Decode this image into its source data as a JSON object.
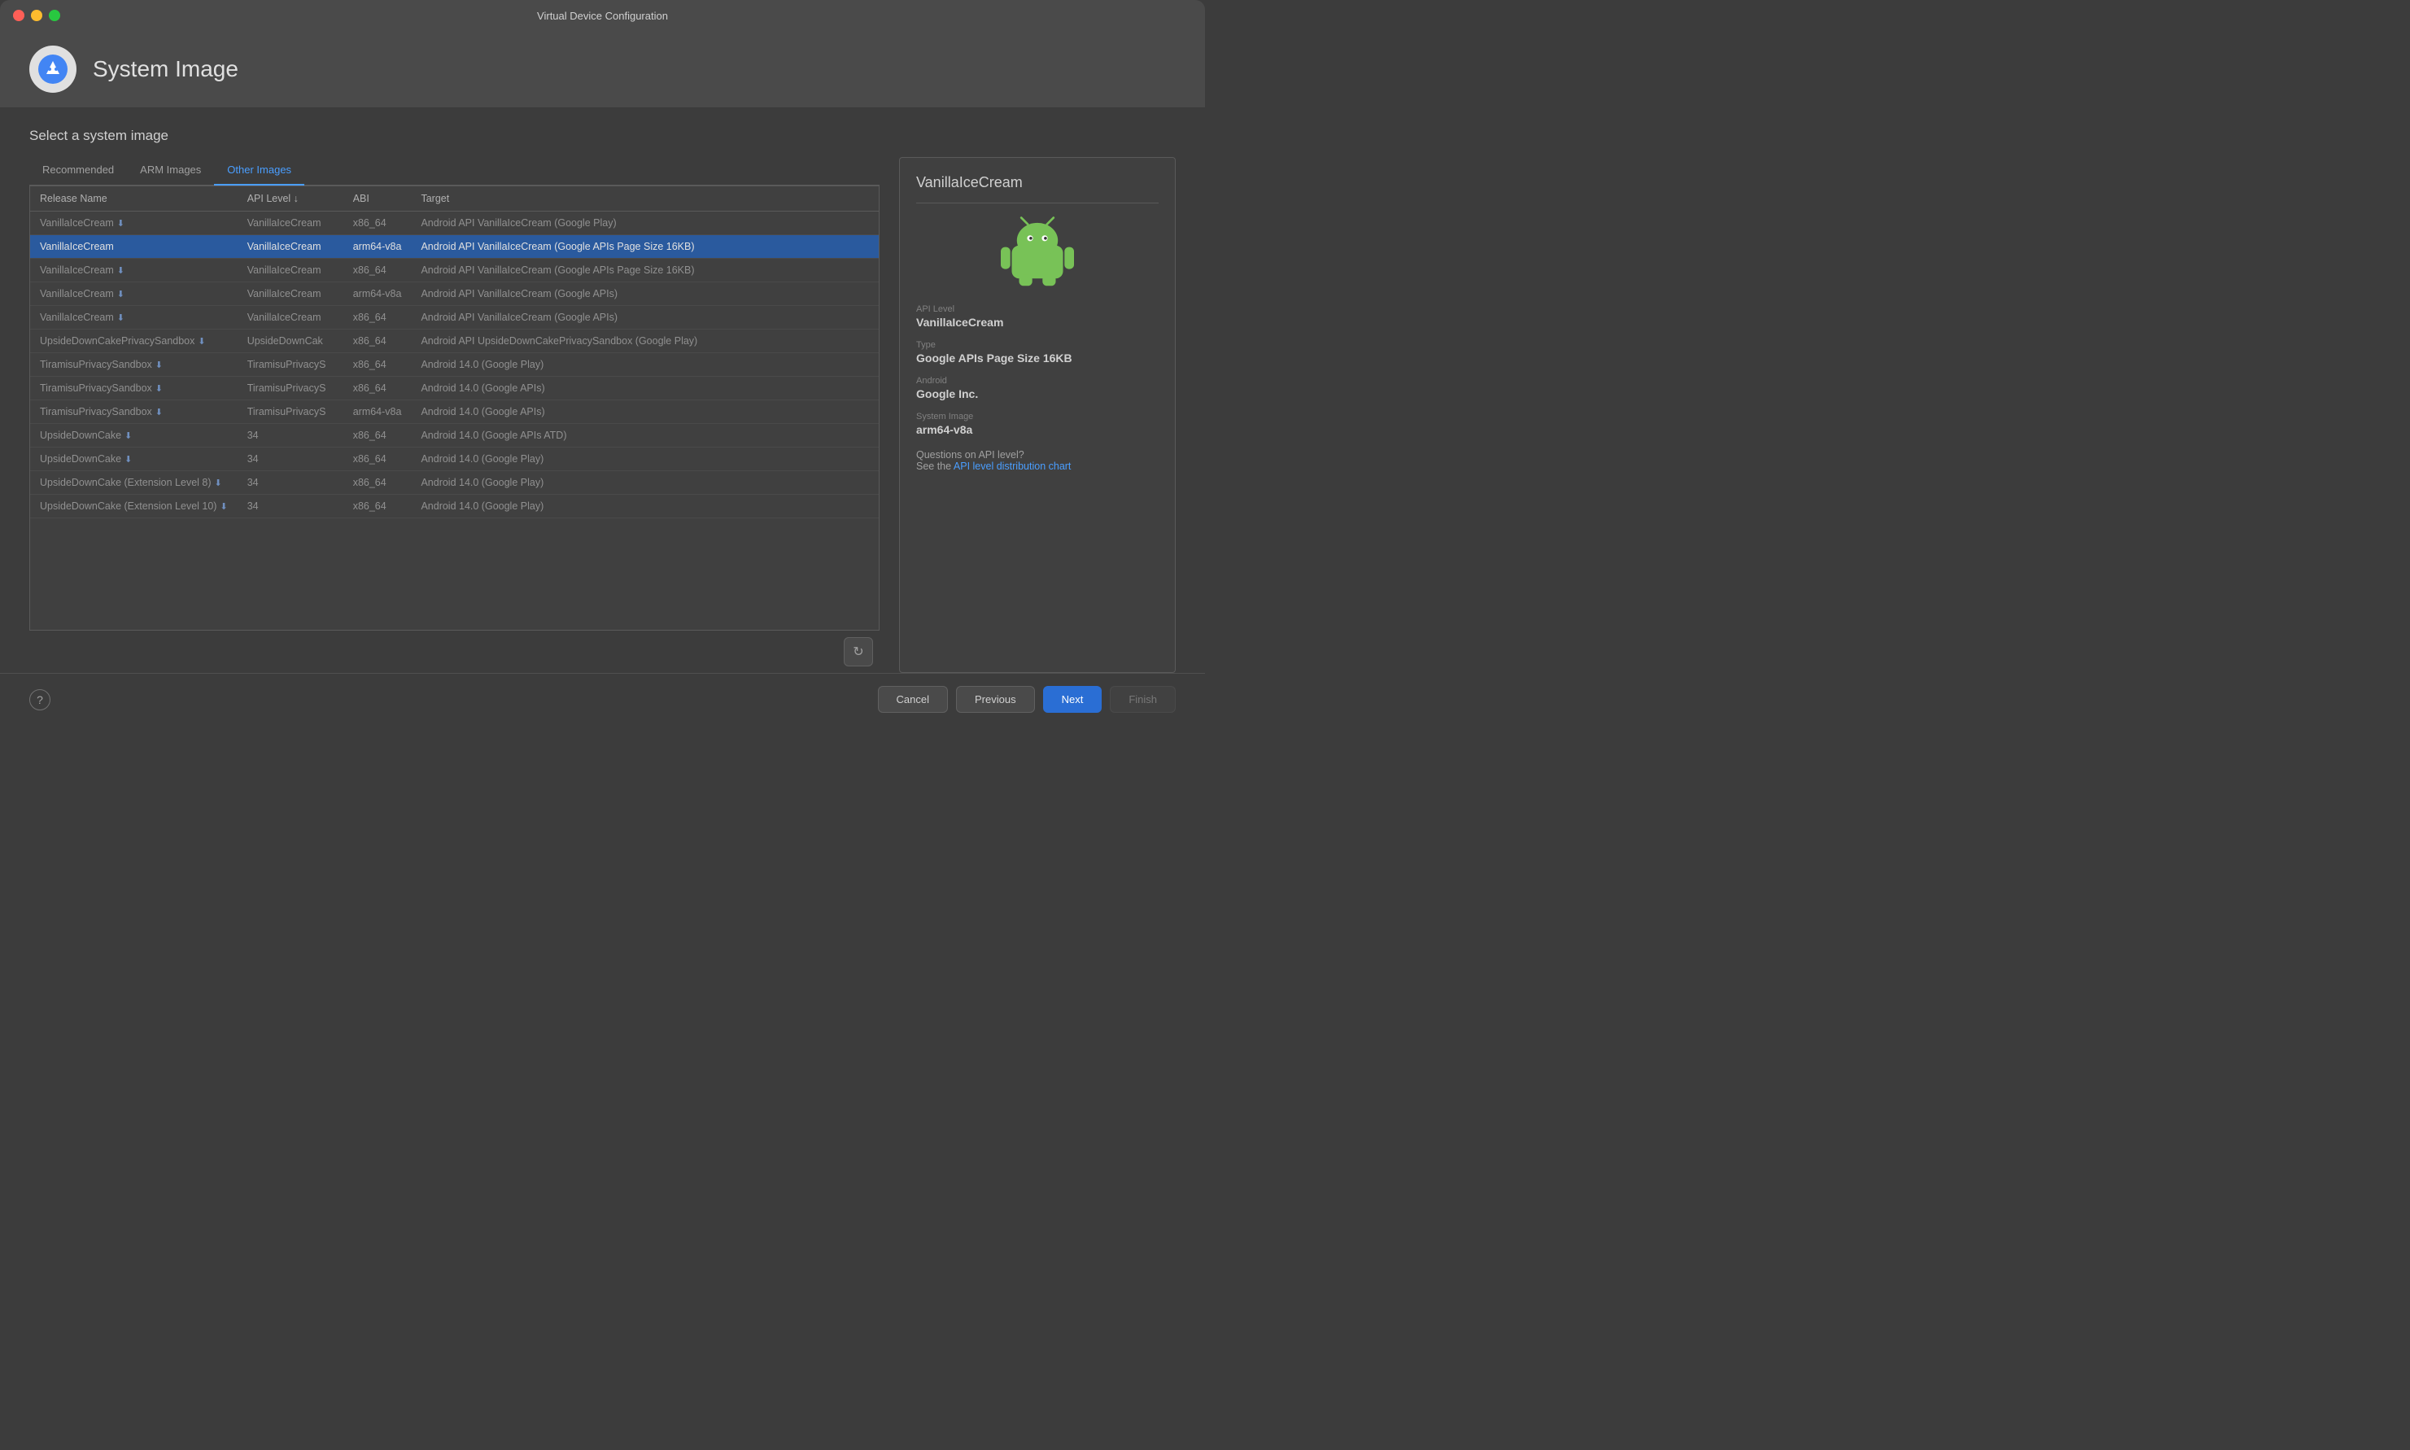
{
  "window": {
    "title": "Virtual Device Configuration"
  },
  "titlebar": {
    "close": "close",
    "minimize": "minimize",
    "maximize": "maximize"
  },
  "header": {
    "icon_alt": "Android Studio Icon",
    "title": "System Image"
  },
  "content": {
    "section_title": "Select a system image",
    "tabs": [
      {
        "label": "Recommended",
        "id": "recommended",
        "active": false
      },
      {
        "label": "ARM Images",
        "id": "arm-images",
        "active": false
      },
      {
        "label": "Other Images",
        "id": "other-images",
        "active": true
      }
    ],
    "table": {
      "columns": [
        {
          "label": "Release Name",
          "sort": null
        },
        {
          "label": "API Level ↓",
          "sort": "desc"
        },
        {
          "label": "ABI",
          "sort": null
        },
        {
          "label": "Target",
          "sort": null
        }
      ],
      "rows": [
        {
          "id": 0,
          "name": "VanillaIceCream",
          "download": true,
          "api": "VanillaIceCream",
          "abi": "x86_64",
          "target": "Android API VanillaIceCream (Google Play)",
          "selected": false
        },
        {
          "id": 1,
          "name": "VanillaIceCream",
          "download": false,
          "api": "VanillaIceCream",
          "abi": "arm64-v8a",
          "target": "Android API VanillaIceCream (Google APIs Page Size 16KB)",
          "selected": true
        },
        {
          "id": 2,
          "name": "VanillaIceCream",
          "download": true,
          "api": "VanillaIceCream",
          "abi": "x86_64",
          "target": "Android API VanillaIceCream (Google APIs Page Size 16KB)",
          "selected": false
        },
        {
          "id": 3,
          "name": "VanillaIceCream",
          "download": true,
          "api": "VanillaIceCream",
          "abi": "arm64-v8a",
          "target": "Android API VanillaIceCream (Google APIs)",
          "selected": false
        },
        {
          "id": 4,
          "name": "VanillaIceCream",
          "download": true,
          "api": "VanillaIceCream",
          "abi": "x86_64",
          "target": "Android API VanillaIceCream (Google APIs)",
          "selected": false
        },
        {
          "id": 5,
          "name": "UpsideDownCakePrivacySandbox",
          "download": true,
          "api": "UpsideDownCak",
          "abi": "x86_64",
          "target": "Android API UpsideDownCakePrivacySandbox (Google Play)",
          "selected": false
        },
        {
          "id": 6,
          "name": "TiramisuPrivacySandbox",
          "download": true,
          "api": "TiramisuPrivacyS",
          "abi": "x86_64",
          "target": "Android 14.0 (Google Play)",
          "selected": false
        },
        {
          "id": 7,
          "name": "TiramisuPrivacySandbox",
          "download": true,
          "api": "TiramisuPrivacyS",
          "abi": "x86_64",
          "target": "Android 14.0 (Google APIs)",
          "selected": false
        },
        {
          "id": 8,
          "name": "TiramisuPrivacySandbox",
          "download": true,
          "api": "TiramisuPrivacyS",
          "abi": "arm64-v8a",
          "target": "Android 14.0 (Google APIs)",
          "selected": false
        },
        {
          "id": 9,
          "name": "UpsideDownCake",
          "download": true,
          "api": "34",
          "abi": "x86_64",
          "target": "Android 14.0 (Google APIs ATD)",
          "selected": false
        },
        {
          "id": 10,
          "name": "UpsideDownCake",
          "download": true,
          "api": "34",
          "abi": "x86_64",
          "target": "Android 14.0 (Google Play)",
          "selected": false
        },
        {
          "id": 11,
          "name": "UpsideDownCake (Extension Level 8)",
          "download": true,
          "api": "34",
          "abi": "x86_64",
          "target": "Android 14.0 (Google Play)",
          "selected": false
        },
        {
          "id": 12,
          "name": "UpsideDownCake (Extension Level 10)",
          "download": true,
          "api": "34",
          "abi": "x86_64",
          "target": "Android 14.0 (Google Play)",
          "selected": false
        }
      ]
    }
  },
  "detail": {
    "name": "VanillaIceCream",
    "api_level_label": "API Level",
    "api_level_value": "VanillaIceCream",
    "type_label": "Type",
    "type_value": "Google APIs Page Size 16KB",
    "android_label": "Android",
    "android_value": "Google Inc.",
    "system_image_label": "System Image",
    "system_image_value": "arm64-v8a",
    "api_question": "Questions on API level?",
    "api_see": "See the",
    "api_link_text": "API level distribution chart"
  },
  "footer": {
    "help": "?",
    "cancel": "Cancel",
    "previous": "Previous",
    "next": "Next",
    "finish": "Finish"
  }
}
